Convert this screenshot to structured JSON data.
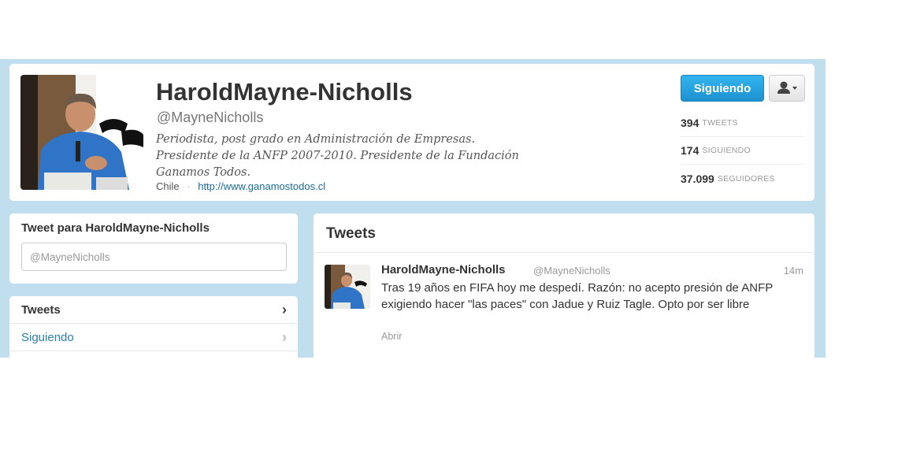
{
  "profile": {
    "name": "HaroldMayne-Nicholls",
    "handle": "@MayneNicholls",
    "bio_lines": [
      "Periodista, post grado en Administración de Empresas.",
      "Presidente de la ANFP 2007-2010. Presidente de la Fundación",
      "Ganamos Todos."
    ],
    "location": "Chile",
    "separator": "·",
    "website": "http://www.ganamostodos.cl",
    "follow_button": "Siguiendo",
    "stats": [
      {
        "value": "394",
        "label": "TWEETS"
      },
      {
        "value": "174",
        "label": "SIGUIENDO"
      },
      {
        "value": "37.099",
        "label": "SEGUIDORES"
      }
    ]
  },
  "compose": {
    "title": "Tweet para HaroldMayne-Nicholls",
    "placeholder": "@MayneNicholls"
  },
  "nav": {
    "items": [
      {
        "label": "Tweets",
        "chevron": "›"
      },
      {
        "label": "Siguiendo",
        "chevron": "›"
      }
    ]
  },
  "timeline": {
    "title": "Tweets",
    "tweet": {
      "name": "HaroldMayne-Nicholls",
      "handle": "@MayneNicholls",
      "time": "14m",
      "text": "Tras 19 años en FIFA hoy me despedí. Razón: no acepto presión de ANFP exigiendo hacer \"las paces\" con Jadue y Ruiz Tagle. Opto por ser libre",
      "open_label": "Abrir"
    }
  },
  "colors": {
    "background": "#c0deed",
    "follow_blue": "#1d91ce",
    "link": "#1a6d96"
  },
  "icons": {
    "user_menu": "person-icon",
    "caret": "caret-down-icon",
    "nav_chevron": "chevron-right-icon"
  }
}
